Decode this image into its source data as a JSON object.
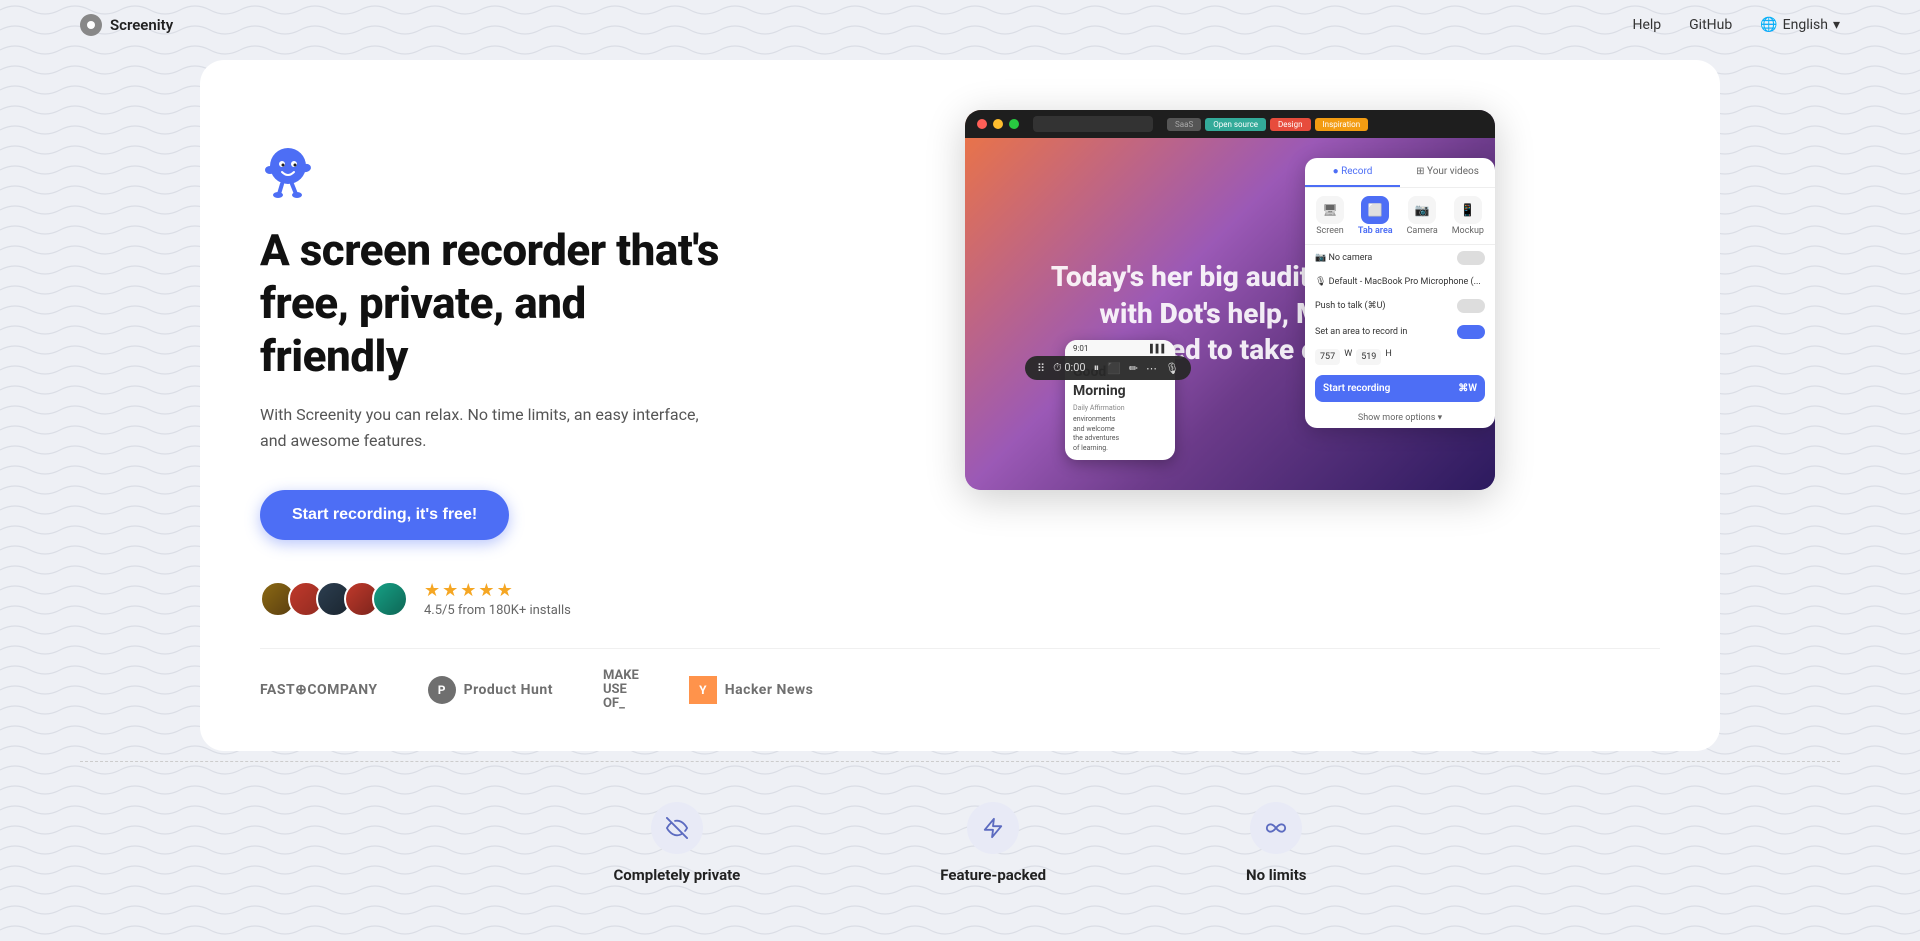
{
  "nav": {
    "logo_text": "Screenity",
    "links": [
      {
        "label": "Help",
        "name": "help-link"
      },
      {
        "label": "GitHub",
        "name": "github-link"
      }
    ],
    "language": {
      "label": "English",
      "icon": "🌐"
    }
  },
  "hero": {
    "headline": "A screen recorder that's free, private, and friendly",
    "subheadline": "With Screenity you can relax. No time limits, an easy interface, and awesome features.",
    "cta_label": "Start recording, it's free!",
    "rating": {
      "score": "4.5/5 from 180K+ installs",
      "stars": [
        "full",
        "full",
        "full",
        "full",
        "half"
      ]
    }
  },
  "recording_panel": {
    "tabs": [
      "Record",
      "Your videos"
    ],
    "icons": [
      "Screen",
      "Tab area",
      "Camera",
      "Mockup"
    ],
    "camera_label": "No camera",
    "camera_toggle": "Off",
    "mic_label": "Default - MacBook Pro Microphone (..)",
    "push_to_talk": "Push to talk (⌘U)",
    "set_area_label": "Set an area to record in",
    "dimensions": {
      "w": "757",
      "w_label": "W",
      "h": "519",
      "h_label": "H"
    },
    "start_button": "Start recording",
    "shortcut": "⌘W",
    "show_more": "Show more options ▾"
  },
  "bg_overlay_text": "Today's her big audition, and\nwith Dot's help, Me...\nprepared to take on l...",
  "phone_content": {
    "time": "9:01",
    "greeting": "Good Morning",
    "affirmation_label": "Daily Affirmation",
    "text": "environments and welcome the adventures of learning."
  },
  "press": [
    {
      "name": "fast-company",
      "label": "FAST COMPANY",
      "has_icon": false
    },
    {
      "name": "product-hunt",
      "label": "Product Hunt",
      "has_icon": true,
      "icon_letter": "P"
    },
    {
      "name": "make-use-of",
      "label": "MAKE\nUSE\nOF_",
      "has_icon": false
    },
    {
      "name": "hacker-news",
      "label": "Hacker News",
      "has_icon": true,
      "icon_letter": "Y"
    }
  ],
  "features": [
    {
      "name": "completely-private",
      "label": "Completely private",
      "icon": "👁️",
      "icon_name": "eye-slash-icon"
    },
    {
      "name": "feature-packed",
      "label": "Feature-packed",
      "icon": "⚡",
      "icon_name": "lightning-icon"
    },
    {
      "name": "no-limits",
      "label": "No limits",
      "icon": "∞",
      "icon_name": "infinity-icon"
    }
  ]
}
